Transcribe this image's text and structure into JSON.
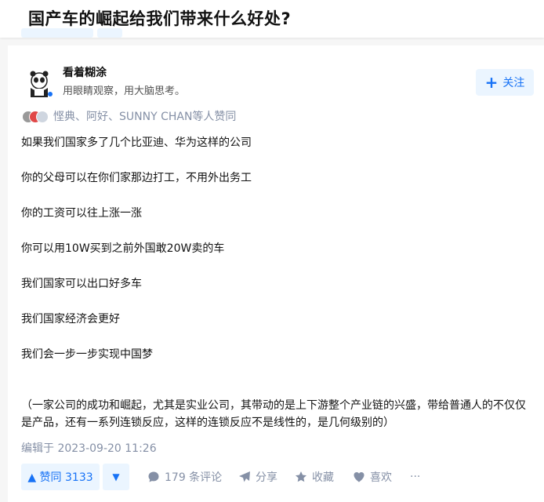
{
  "question": {
    "title": "国产车的崛起给我们带来什么好处?"
  },
  "author": {
    "name": "看着糊涂",
    "bio": "用眼睛观察，用大脑思考。",
    "follow_label": "关注"
  },
  "voters": {
    "text": "悭典、阿好、SUNNY CHAN等人赞同"
  },
  "answer": {
    "paragraphs": [
      "如果我们国家多了几个比亚迪、华为这样的公司",
      "你的父母可以在你们家那边打工，不用外出务工",
      "你的工资可以往上涨一涨",
      "你可以用10W买到之前外国敢20W卖的车",
      "我们国家可以出口好多车",
      "我们国家经济会更好",
      "我们会一步一步实现中国梦"
    ],
    "note": "（一家公司的成功和崛起，尤其是实业公司，其带动的是上下游整个产业链的兴盛，带给普通人的不仅仅是产品，还有一系列连锁反应，这样的连锁反应不是线性的，是几何级别的）",
    "edit_time": "编辑于 2023-09-20 11:26"
  },
  "actions": {
    "vote_up": "▲ 赞同 3133",
    "vote_down": "▼",
    "comments": "179 条评论",
    "share": "分享",
    "collect": "收藏",
    "like": "喜欢",
    "more": "···"
  },
  "icons": {
    "follow": "plus-icon",
    "comments": "comment-bubble-icon",
    "share": "paper-plane-icon",
    "collect": "star-icon",
    "like": "heart-icon",
    "more": "ellipsis-icon"
  },
  "colors": {
    "accent": "#1772f6",
    "accent_bg": "#ebf5ff",
    "meta": "#8590a6"
  }
}
